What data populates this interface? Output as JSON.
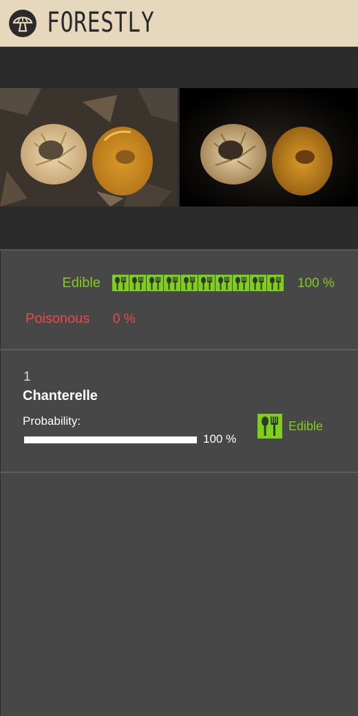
{
  "app": {
    "brand": "FORESTLY",
    "logo_icon": "mushroom-logo-icon"
  },
  "images": {
    "original_icon": "mushroom-photo",
    "processed_icon": "mushroom-photo-vignette"
  },
  "summary": {
    "edible_label": "Edible",
    "edible_percent": "100 %",
    "edible_fraction": 1.0,
    "edible_icon": "fork-spoon-icon",
    "edible_color": "#7fce1b",
    "poisonous_label": "Poisonous",
    "poisonous_percent": "0 %",
    "poisonous_fraction": 0.0,
    "poisonous_color": "#e84a4a"
  },
  "results": [
    {
      "rank": "1",
      "name": "Chanterelle",
      "probability_label": "Probability:",
      "probability_percent": "100 %",
      "probability_fraction": 1.0,
      "edibility_label": "Edible",
      "edibility_icon": "fork-spoon-icon"
    }
  ]
}
